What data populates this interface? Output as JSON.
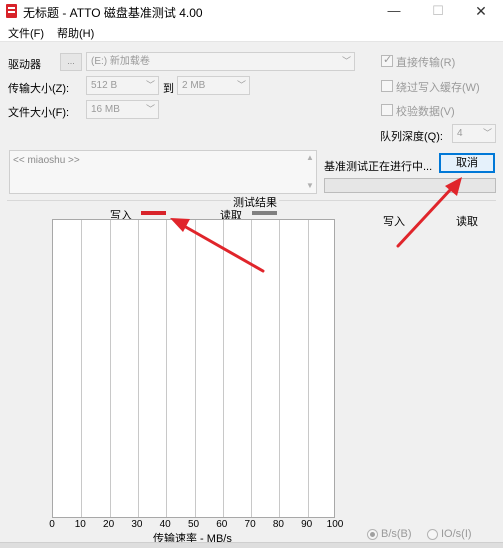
{
  "window": {
    "title": "无标题 - ATTO 磁盘基准测试 4.00",
    "min_glyph": "—",
    "max_glyph": "☐",
    "close_glyph": "✕"
  },
  "menu": {
    "file": "文件(F)",
    "help": "帮助(H)"
  },
  "settings": {
    "drive_label": "驱动器",
    "browse": "...",
    "drive_value": "(E:) 新加载卷",
    "transfer_label": "传输大小(Z):",
    "transfer_from": "512 B",
    "to_label": "到",
    "transfer_to": "2 MB",
    "file_size_label": "文件大小(F):",
    "file_size": "16 MB"
  },
  "options": {
    "direct_io": {
      "label": "直接传输(R)",
      "checked": true
    },
    "bypass_write_cache": {
      "label": "绕过写入缓存(W)",
      "checked": false
    },
    "verify_data": {
      "label": "校验数据(V)",
      "checked": false
    },
    "queue_depth_label": "队列深度(Q):",
    "queue_depth": "4"
  },
  "description": {
    "placeholder": "<< miaoshu >>"
  },
  "status": {
    "text": "基准测试正在进行中...",
    "cancel": "取消",
    "progress": 0
  },
  "results": {
    "title": "测试结果",
    "legend_write": "写入",
    "legend_read": "读取",
    "col_write": "写入",
    "col_read": "读取",
    "x_ticks": [
      "0",
      "10",
      "20",
      "30",
      "40",
      "50",
      "60",
      "70",
      "80",
      "90",
      "100"
    ],
    "xlabel": "传输速率 - MB/s",
    "unit_bytes": "B/s(B)",
    "unit_io": "IO/s(I)",
    "unit_selected": "bytes"
  },
  "colors": {
    "write": "#d8232a",
    "read": "#808080",
    "accent": "#0078d7",
    "annotation_arrow": "#e0252b"
  }
}
